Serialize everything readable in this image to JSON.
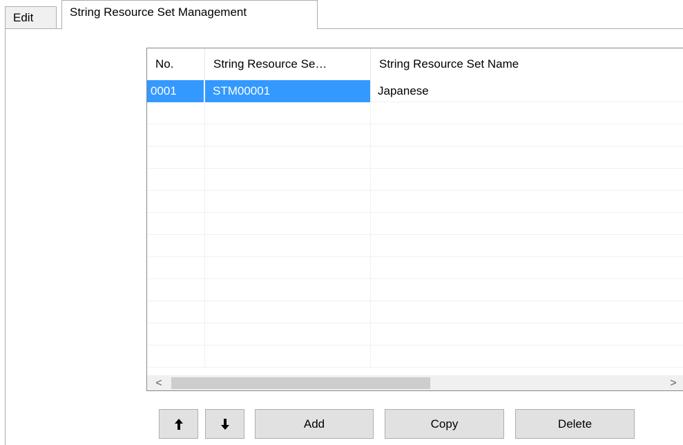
{
  "tabs": [
    {
      "label": "Edit",
      "active": false
    },
    {
      "label": "String Resource Set Management",
      "active": true
    }
  ],
  "grid": {
    "columns": [
      "No.",
      "String Resource Se…",
      "String Resource Set Name"
    ],
    "rows": [
      {
        "no": "0001",
        "id": "STM00001",
        "name": "Japanese",
        "selected": true
      }
    ],
    "empty_row_count": 12,
    "selection_color": "#3399ff"
  },
  "scrollbar": {
    "left_arrow": "<",
    "right_arrow": ">"
  },
  "buttons": {
    "move_up_icon": "arrow-up-icon",
    "move_down_icon": "arrow-down-icon",
    "add": "Add",
    "copy": "Copy",
    "delete": "Delete"
  }
}
